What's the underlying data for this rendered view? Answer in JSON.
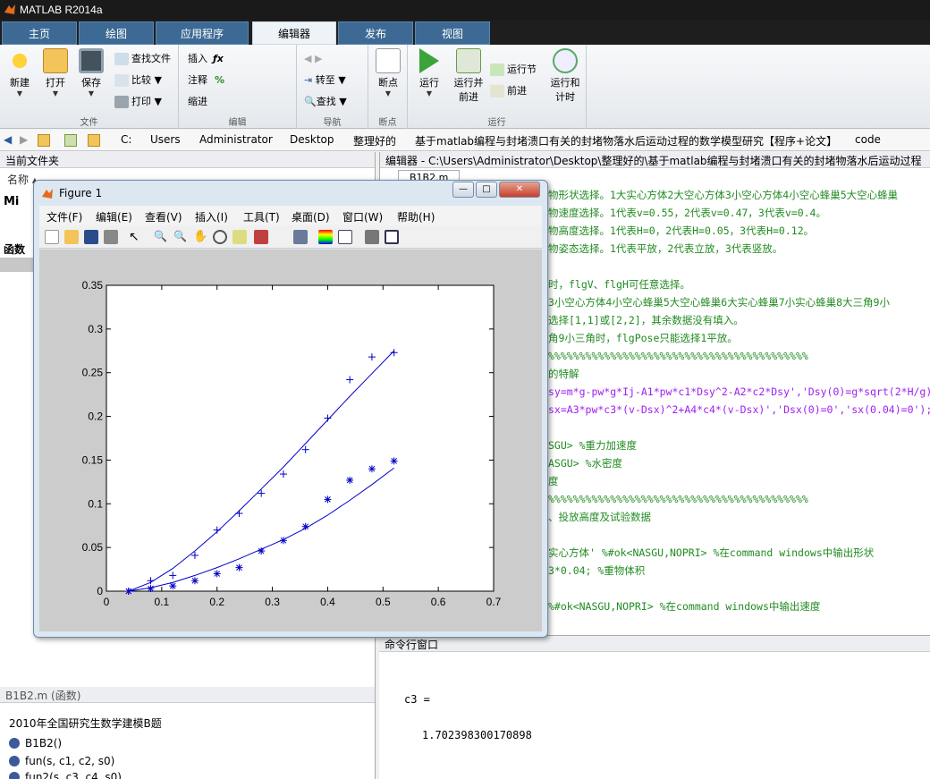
{
  "window": {
    "title": "MATLAB R2014a"
  },
  "tabs": [
    {
      "label": "主页",
      "active": false
    },
    {
      "label": "绘图",
      "active": false
    },
    {
      "label": "应用程序",
      "active": false
    },
    {
      "label": "编辑器",
      "active": true
    },
    {
      "label": "发布",
      "active": false
    },
    {
      "label": "视图",
      "active": false
    }
  ],
  "ribbon": {
    "file": {
      "new": "新建",
      "open": "打开",
      "save": "保存",
      "find_files": "查找文件",
      "compare": "比较",
      "print": "打印",
      "group": "文件"
    },
    "edit": {
      "insert": "插入",
      "comment": "注释",
      "indent": "缩进",
      "group": "编辑"
    },
    "navigate": {
      "goto": "转至",
      "find": "查找",
      "group": "导航"
    },
    "breakpoints": {
      "label": "断点",
      "group": "断点"
    },
    "run": {
      "run": "运行",
      "run_advance": "运行并\n前进",
      "run_section": "运行节",
      "advance": "前进",
      "run_time": "运行和\n计时",
      "group": "运行"
    }
  },
  "address": [
    "C:",
    "Users",
    "Administrator",
    "Desktop",
    "整理好的",
    "基于matlab编程与封堵溃口有关的封堵物落水后运动过程的数学模型研究【程序+论文】",
    "code"
  ],
  "current_folder": {
    "header": "当前文件夹",
    "name_col": "名称 ▴"
  },
  "details": {
    "header": "B1B2.m (函数)",
    "description": "2010年全国研究生数学建模B题",
    "functions": [
      "B1B2()",
      "fun(s, c1, c2, s0)",
      "fun2(s, c3, c4, s0)"
    ]
  },
  "editor": {
    "header": "编辑器 - C:\\Users\\Administrator\\Desktop\\整理好的\\基于matlab编程与封堵溃口有关的封堵物落水后运动过程",
    "tab": "B1B2.m",
    "lines": [
      {
        "text": "物形状选择。1大实心方体2大空心方体3小空心方体4小空心蜂巢5大空心蜂巢",
        "cls": "green"
      },
      {
        "text": "物速度选择。1代表v=0.55，2代表v=0.47，3代表v=0.4。",
        "cls": "green"
      },
      {
        "text": "物高度选择。1代表H=0，2代表H=0.05，3代表H=0.12。",
        "cls": "green"
      },
      {
        "text": "物姿态选择。1代表平放，2代表立放，3代表竖放。",
        "cls": "green"
      },
      {
        "text": "",
        "cls": ""
      },
      {
        "text": "时，flgV、flgH可任意选择。",
        "cls": "green"
      },
      {
        "text": "3小空心方体4小空心蜂巢5大空心蜂巢6大实心蜂巢7小实心蜂巢8大三角9小",
        "cls": "green"
      },
      {
        "text": "选择[1,1]或[2,2]，其余数据没有填入。",
        "cls": "green"
      },
      {
        "text": "角9小三角时，flgPose只能选择1平放。",
        "cls": "green"
      },
      {
        "text": "%%%%%%%%%%%%%%%%%%%%%%%%%%%%%%%%%%%%%%%%%%",
        "cls": "green"
      },
      {
        "text": "的特解",
        "cls": "green"
      },
      {
        "text": "sy=m*g-pw*g*Ij-A1*pw*c1*Dsy^2-A2*c2*Dsy','Dsy(0)=g*sqrt(2*H/g)",
        "cls": "purple"
      },
      {
        "text": "sx=A3*pw*c3*(v-Dsx)^2+A4*c4*(v-Dsx)','Dsx(0)=0','sx(0.04)=0');",
        "cls": "purple"
      },
      {
        "text": "",
        "cls": ""
      },
      {
        "text": "SGU> %重力加速度",
        "cls": "green"
      },
      {
        "text": "ASGU> %水密度",
        "cls": "green"
      },
      {
        "text": "度",
        "cls": "green"
      },
      {
        "text": "%%%%%%%%%%%%%%%%%%%%%%%%%%%%%%%%%%%%%%%%%%",
        "cls": "green"
      },
      {
        "text": "、投放高度及试验数据",
        "cls": "green"
      },
      {
        "text": "",
        "cls": ""
      },
      {
        "text": "实心方体' %#ok<NASGU,NOPRI> %在command windows中输出形状",
        "cls": "green"
      },
      {
        "text": "3*0.04; %重物体积",
        "cls": "green"
      },
      {
        "text": "",
        "cls": ""
      },
      {
        "text": "%#ok<NASGU,NOPRI> %在command windows中输出速度",
        "cls": "green"
      }
    ]
  },
  "command_window": {
    "header": "命令行窗口",
    "var": "c3 =",
    "value": "1.702398300170898"
  },
  "figure": {
    "title": "Figure 1",
    "menu": [
      "文件(F)",
      "编辑(E)",
      "查看(V)",
      "插入(I)",
      "工具(T)",
      "桌面(D)",
      "窗口(W)",
      "帮助(H)"
    ],
    "peek_text": "Mi",
    "peek_text2": "函数"
  },
  "chart_data": {
    "type": "scatter",
    "title": "",
    "xlabel": "",
    "ylabel": "",
    "xlim": [
      0,
      0.7
    ],
    "ylim": [
      0,
      0.35
    ],
    "xticks": [
      "0",
      "0.1",
      "0.2",
      "0.3",
      "0.4",
      "0.5",
      "0.6",
      "0.7"
    ],
    "yticks": [
      "0",
      "0.05",
      "0.1",
      "0.15",
      "0.2",
      "0.25",
      "0.3",
      "0.35"
    ],
    "series": [
      {
        "marker": "+",
        "color": "#0000c8",
        "x": [
          0.04,
          0.08,
          0.12,
          0.16,
          0.2,
          0.24,
          0.28,
          0.32,
          0.36,
          0.4,
          0.44,
          0.48,
          0.52
        ],
        "y": [
          0,
          0.012,
          0.018,
          0.041,
          0.07,
          0.089,
          0.112,
          0.134,
          0.162,
          0.198,
          0.242,
          0.268,
          0.273
        ]
      },
      {
        "marker": "*",
        "color": "#0000c8",
        "x": [
          0.04,
          0.08,
          0.12,
          0.16,
          0.2,
          0.24,
          0.28,
          0.32,
          0.36,
          0.4,
          0.44,
          0.48,
          0.52
        ],
        "y": [
          0,
          0.003,
          0.006,
          0.012,
          0.02,
          0.027,
          0.046,
          0.058,
          0.074,
          0.105,
          0.127,
          0.14,
          0.149
        ]
      },
      {
        "type": "line",
        "color": "#0000c8",
        "x": [
          0.04,
          0.08,
          0.12,
          0.16,
          0.2,
          0.24,
          0.28,
          0.32,
          0.36,
          0.4,
          0.44,
          0.48,
          0.52
        ],
        "y": [
          0,
          0.01,
          0.026,
          0.046,
          0.068,
          0.092,
          0.117,
          0.142,
          0.169,
          0.196,
          0.223,
          0.249,
          0.275
        ]
      },
      {
        "type": "line",
        "color": "#0000c8",
        "x": [
          0.04,
          0.08,
          0.12,
          0.16,
          0.2,
          0.24,
          0.28,
          0.32,
          0.36,
          0.4,
          0.44,
          0.48,
          0.52
        ],
        "y": [
          0,
          0.004,
          0.01,
          0.018,
          0.027,
          0.037,
          0.048,
          0.059,
          0.072,
          0.087,
          0.104,
          0.122,
          0.141
        ]
      }
    ]
  }
}
